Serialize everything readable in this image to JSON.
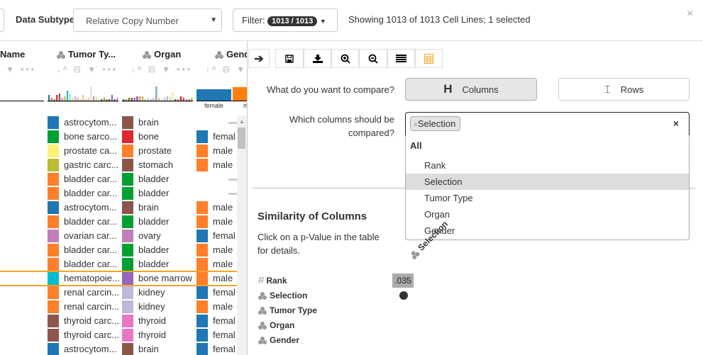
{
  "toolbar": {
    "data_subtype_label": "Data Subtype",
    "data_subtype_value": "Relative Copy Number",
    "filter_label": "Filter:",
    "filter_badge": "1013 / 1013",
    "status": "Showing 1013 of 1013 Cell Lines; 1 selected",
    "close": "×"
  },
  "table": {
    "columns": [
      {
        "label": "Name"
      },
      {
        "label": "Tumor Ty..."
      },
      {
        "label": "Organ"
      },
      {
        "label": "Gend"
      }
    ],
    "gender_hist": {
      "labels": [
        "female",
        "m"
      ],
      "colors": [
        "#1f77b4",
        "#ff7f0e"
      ]
    },
    "tumor_hist": [
      {
        "v": 4,
        "c": "#1f77b4"
      },
      {
        "v": 2,
        "c": "#ff7f0e"
      },
      {
        "v": 1,
        "c": "#2ca02c"
      },
      {
        "v": 4,
        "c": "#d62728"
      },
      {
        "v": 5,
        "c": "#8c564b"
      },
      {
        "v": 2,
        "c": "#e377c2"
      },
      {
        "v": 3,
        "c": "#bcbd22"
      },
      {
        "v": 7,
        "c": "#17becf"
      },
      {
        "v": 5,
        "c": "#9edae5"
      },
      {
        "v": 2,
        "c": "#dbdb8d"
      },
      {
        "v": 3,
        "c": "#c5b0d5"
      },
      {
        "v": 2,
        "c": "#ff9896"
      },
      {
        "v": 1,
        "c": "#aec7e8"
      },
      {
        "v": 4,
        "c": "#ffbb78"
      },
      {
        "v": 1,
        "c": "#98df8a"
      },
      {
        "v": 2,
        "c": "#f7b6d2"
      },
      {
        "v": 10,
        "c": "#dddddd"
      },
      {
        "v": 3,
        "c": "#c49c94"
      },
      {
        "v": 3,
        "c": "#c7e9c0"
      },
      {
        "v": 1,
        "c": "#ffe680"
      },
      {
        "v": 1,
        "c": "#1f77b4"
      },
      {
        "v": 2,
        "c": "#ff7f0e"
      },
      {
        "v": 1,
        "c": "#2ca02c"
      },
      {
        "v": 1,
        "c": "#d62728"
      },
      {
        "v": 4,
        "c": "#9467bd"
      },
      {
        "v": 1,
        "c": "#8c564b"
      },
      {
        "v": 2,
        "c": "#e377c2"
      }
    ],
    "organ_hist": [
      {
        "v": 1,
        "c": "#1f77b4"
      },
      {
        "v": 1,
        "c": "#ff7f0e"
      },
      {
        "v": 2,
        "c": "#2ca02c"
      },
      {
        "v": 2,
        "c": "#d62728"
      },
      {
        "v": 2,
        "c": "#9467bd"
      },
      {
        "v": 3,
        "c": "#8c564b"
      },
      {
        "v": 3,
        "c": "#e377c2"
      },
      {
        "v": 3,
        "c": "#bcbd22"
      },
      {
        "v": 1,
        "c": "#98df8a"
      },
      {
        "v": 2,
        "c": "#9edae5"
      },
      {
        "v": 1,
        "c": "#c5b0d5"
      },
      {
        "v": 2,
        "c": "#ff9896"
      },
      {
        "v": 10,
        "c": "#6baed6"
      },
      {
        "v": 2,
        "c": "#ffbb78"
      },
      {
        "v": 1,
        "c": "#dddddd"
      },
      {
        "v": 2,
        "c": "#c7c7c7"
      },
      {
        "v": 3,
        "c": "#c5b0d5"
      },
      {
        "v": 3,
        "c": "#c7e9c0"
      },
      {
        "v": 6,
        "c": "#ffe680"
      },
      {
        "v": 1,
        "c": "#1f77b4"
      },
      {
        "v": 1,
        "c": "#ff7f0e"
      },
      {
        "v": 3,
        "c": "#d62728"
      },
      {
        "v": 2,
        "c": "#8c564b"
      },
      {
        "v": 1,
        "c": "#e377c2"
      },
      {
        "v": 1,
        "c": "#7f7f7f"
      },
      {
        "v": 2,
        "c": "#bcbd22"
      }
    ],
    "rows": [
      {
        "tumor": "astrocytom...",
        "tc": "#1f77b4",
        "organ": "brain",
        "oc": "#8c564b",
        "gender": "",
        "gc": ""
      },
      {
        "tumor": "bone sarco...",
        "tc": "#00a032",
        "organ": "bone",
        "oc": "#e0262f",
        "gender": "femal",
        "gc": "#1f77b4"
      },
      {
        "tumor": "prostate ca...",
        "tc": "#fff07a",
        "organ": "prostate",
        "oc": "#ff7f2a",
        "gender": "male",
        "gc": "#ff7f2a"
      },
      {
        "tumor": "gastric carc...",
        "tc": "#bcbd35",
        "organ": "stomach",
        "oc": "#8c564b",
        "gender": "male",
        "gc": "#ff7f2a"
      },
      {
        "tumor": "bladder car...",
        "tc": "#ff7f2a",
        "organ": "bladder",
        "oc": "#00a032",
        "gender": "",
        "gc": ""
      },
      {
        "tumor": "bladder car...",
        "tc": "#ff7f2a",
        "organ": "bladder",
        "oc": "#00a032",
        "gender": "",
        "gc": ""
      },
      {
        "tumor": "astrocytom...",
        "tc": "#1f77b4",
        "organ": "brain",
        "oc": "#8c564b",
        "gender": "male",
        "gc": "#ff7f2a"
      },
      {
        "tumor": "bladder car...",
        "tc": "#ff7f2a",
        "organ": "bladder",
        "oc": "#00a032",
        "gender": "male",
        "gc": "#ff7f2a"
      },
      {
        "tumor": "ovarian car...",
        "tc": "#c07fbb",
        "organ": "ovary",
        "oc": "#c07fbb",
        "gender": "femal",
        "gc": "#1f77b4"
      },
      {
        "tumor": "bladder car...",
        "tc": "#ff7f2a",
        "organ": "bladder",
        "oc": "#00a032",
        "gender": "male",
        "gc": "#ff7f2a"
      },
      {
        "tumor": "bladder car...",
        "tc": "#ff7f2a",
        "organ": "bladder",
        "oc": "#00a032",
        "gender": "male",
        "gc": "#ff7f2a"
      },
      {
        "tumor": "hematopoie...",
        "tc": "#00bcd0",
        "organ": "bone marrow",
        "oc": "#9467bd",
        "gender": "male",
        "gc": "#ff7f2a",
        "selected": true
      },
      {
        "tumor": "renal carcin...",
        "tc": "#ff7f2a",
        "organ": "kidney",
        "oc": "#c0b8d8",
        "gender": "femal",
        "gc": "#1f77b4"
      },
      {
        "tumor": "renal carcin...",
        "tc": "#ff7f2a",
        "organ": "kidney",
        "oc": "#c0b8d8",
        "gender": "male",
        "gc": "#ff7f2a"
      },
      {
        "tumor": "thyroid carc...",
        "tc": "#8c564b",
        "organ": "thyroid",
        "oc": "#e877c2",
        "gender": "femal",
        "gc": "#1f77b4"
      },
      {
        "tumor": "thyroid carc...",
        "tc": "#8c564b",
        "organ": "thyroid",
        "oc": "#e877c2",
        "gender": "femal",
        "gc": "#1f77b4"
      },
      {
        "tumor": "astrocytom...",
        "tc": "#1f77b4",
        "organ": "brain",
        "oc": "#8c564b",
        "gender": "femal",
        "gc": "#1f77b4"
      }
    ],
    "selection_color": "#f5a623"
  },
  "panel": {
    "toolbar_icons": [
      "arrow-right-icon",
      "save-icon",
      "download-icon",
      "zoom-in-icon",
      "zoom-out-icon",
      "list-icon",
      "table-icon"
    ],
    "compare_question": "What do you want to compare?",
    "columns_button": "Columns",
    "rows_button": "Rows",
    "columns_question_1": "Which columns should be",
    "columns_question_2": "compared?",
    "selected_tag": "Selection",
    "dropdown": {
      "group": "All",
      "options": [
        "Rank",
        "Selection",
        "Tumor Type",
        "Organ",
        "Gender"
      ],
      "highlighted": "Selection"
    },
    "similarity_title": "Similarity of Columns",
    "similarity_hint_1": "Click on a p-Value in the table",
    "similarity_hint_2": "for details.",
    "matrix_col_header": "Selection",
    "matrix_rows": [
      {
        "label": "Rank",
        "icon": "hash-icon",
        "value": ".035"
      },
      {
        "label": "Selection",
        "icon": "categorical-icon",
        "value": ""
      },
      {
        "label": "Tumor Type",
        "icon": "categorical-icon"
      },
      {
        "label": "Organ",
        "icon": "categorical-icon"
      },
      {
        "label": "Gender",
        "icon": "categorical-icon"
      }
    ]
  }
}
